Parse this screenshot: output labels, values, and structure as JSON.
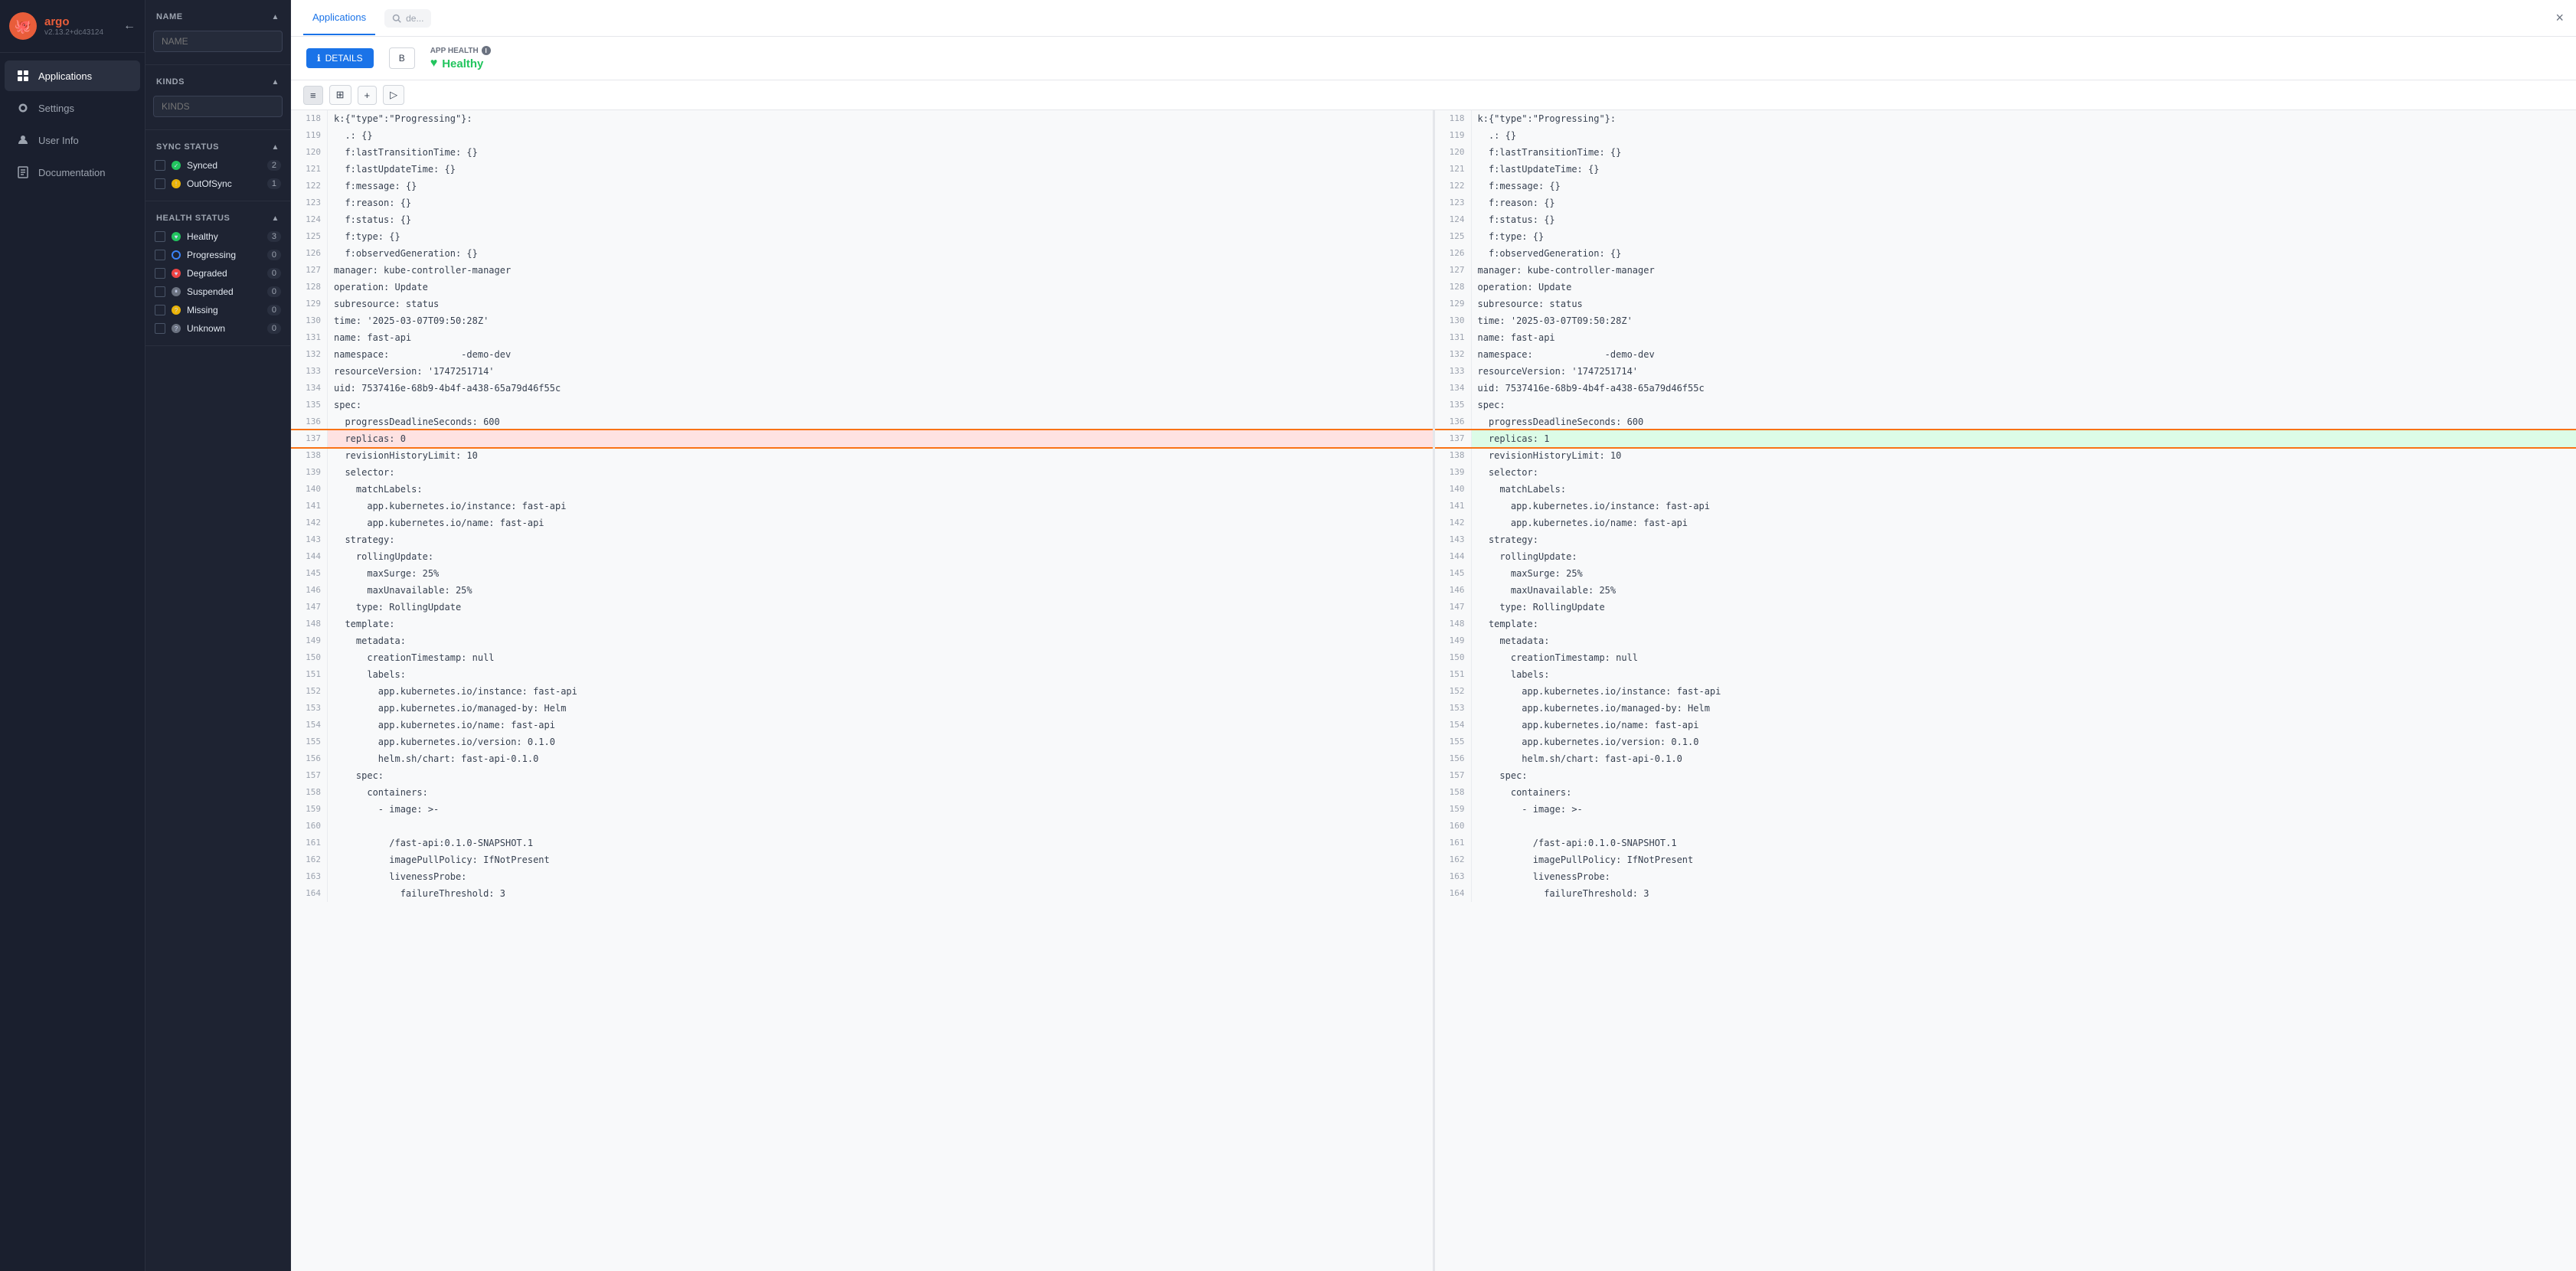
{
  "sidebar": {
    "logo": {
      "name": "argo",
      "version": "v2.13.2+dc43124"
    },
    "nav_items": [
      {
        "id": "applications",
        "label": "Applications",
        "icon": "grid",
        "active": true
      },
      {
        "id": "settings",
        "label": "Settings",
        "icon": "gear",
        "active": false
      },
      {
        "id": "user-info",
        "label": "User Info",
        "icon": "user",
        "active": false
      },
      {
        "id": "documentation",
        "label": "Documentation",
        "icon": "book",
        "active": false
      }
    ]
  },
  "filter": {
    "name_label": "NAME",
    "name_placeholder": "NAME",
    "kinds_label": "KINDS",
    "kinds_placeholder": "KINDS",
    "sync_status_label": "SYNC STATUS",
    "sync_items": [
      {
        "label": "Synced",
        "count": "2",
        "status": "synced"
      },
      {
        "label": "OutOfSync",
        "count": "1",
        "status": "outofsync"
      }
    ],
    "health_status_label": "HEALTH STATUS",
    "health_items": [
      {
        "label": "Healthy",
        "count": "3",
        "status": "healthy"
      },
      {
        "label": "Progressing",
        "count": "0",
        "status": "progressing"
      },
      {
        "label": "Degraded",
        "count": "0",
        "status": "degraded"
      },
      {
        "label": "Suspended",
        "count": "0",
        "status": "suspended"
      },
      {
        "label": "Missing",
        "count": "0",
        "status": "missing"
      },
      {
        "label": "Unknown",
        "count": "0",
        "status": "unknown"
      }
    ]
  },
  "topbar": {
    "tabs": [
      {
        "label": "Applications",
        "active": true
      },
      {
        "label": "de...",
        "active": false
      }
    ],
    "search_placeholder": "de..."
  },
  "app_header": {
    "details_btn": "DETAILS",
    "second_btn": "B",
    "health_label": "APP HEALTH",
    "health_info": "ℹ",
    "health_value": "Healthy"
  },
  "toolbar": {
    "icons": [
      "≡",
      "⊞",
      "+",
      "▷"
    ]
  },
  "diff": {
    "lines": [
      {
        "num": 118,
        "content": "k:{\"type\":\"Progressing\"}:"
      },
      {
        "num": 119,
        "content": "  .: {}"
      },
      {
        "num": 120,
        "content": "  f:lastTransitionTime: {}"
      },
      {
        "num": 121,
        "content": "  f:lastUpdateTime: {}"
      },
      {
        "num": 122,
        "content": "  f:message: {}"
      },
      {
        "num": 123,
        "content": "  f:reason: {}"
      },
      {
        "num": 124,
        "content": "  f:status: {}"
      },
      {
        "num": 125,
        "content": "  f:type: {}"
      },
      {
        "num": 126,
        "content": "  f:observedGeneration: {}"
      },
      {
        "num": 127,
        "content": "manager: kube-controller-manager"
      },
      {
        "num": 128,
        "content": "operation: Update"
      },
      {
        "num": 129,
        "content": "subresource: status"
      },
      {
        "num": 130,
        "content": "time: '2025-03-07T09:50:28Z'"
      },
      {
        "num": 131,
        "content": "name: fast-api"
      },
      {
        "num": 132,
        "content": "namespace:             -demo-dev"
      },
      {
        "num": 133,
        "content": "resourceVersion: '1747251714'"
      },
      {
        "num": 134,
        "content": "uid: 7537416e-68b9-4b4f-a438-65a79d46f55c"
      },
      {
        "num": 135,
        "content": "spec:"
      },
      {
        "num": 136,
        "content": "  progressDeadlineSeconds: 600"
      },
      {
        "num": 137,
        "content": "  replicas: 0",
        "highlight": "remove"
      },
      {
        "num": 138,
        "content": "  revisionHistoryLimit: 10"
      },
      {
        "num": 139,
        "content": "  selector:"
      },
      {
        "num": 140,
        "content": "    matchLabels:"
      },
      {
        "num": 141,
        "content": "      app.kubernetes.io/instance: fast-api"
      },
      {
        "num": 142,
        "content": "      app.kubernetes.io/name: fast-api"
      },
      {
        "num": 143,
        "content": "  strategy:"
      },
      {
        "num": 144,
        "content": "    rollingUpdate:"
      },
      {
        "num": 145,
        "content": "      maxSurge: 25%"
      },
      {
        "num": 146,
        "content": "      maxUnavailable: 25%"
      },
      {
        "num": 147,
        "content": "    type: RollingUpdate"
      },
      {
        "num": 148,
        "content": "  template:"
      },
      {
        "num": 149,
        "content": "    metadata:"
      },
      {
        "num": 150,
        "content": "      creationTimestamp: null"
      },
      {
        "num": 151,
        "content": "      labels:"
      },
      {
        "num": 152,
        "content": "        app.kubernetes.io/instance: fast-api"
      },
      {
        "num": 153,
        "content": "        app.kubernetes.io/managed-by: Helm"
      },
      {
        "num": 154,
        "content": "        app.kubernetes.io/name: fast-api"
      },
      {
        "num": 155,
        "content": "        app.kubernetes.io/version: 0.1.0"
      },
      {
        "num": 156,
        "content": "        helm.sh/chart: fast-api-0.1.0"
      },
      {
        "num": 157,
        "content": "    spec:"
      },
      {
        "num": 158,
        "content": "      containers:"
      },
      {
        "num": 159,
        "content": "        - image: >-"
      },
      {
        "num": 160,
        "content": ""
      },
      {
        "num": 161,
        "content": "          /fast-api:0.1.0-SNAPSHOT.1"
      },
      {
        "num": 162,
        "content": "          imagePullPolicy: IfNotPresent"
      },
      {
        "num": 163,
        "content": "          livenessProbe:"
      },
      {
        "num": 164,
        "content": "            failureThreshold: 3"
      }
    ],
    "right_lines": [
      {
        "num": 118,
        "content": "k:{\"type\":\"Progressing\"}:"
      },
      {
        "num": 119,
        "content": "  .: {}"
      },
      {
        "num": 120,
        "content": "  f:lastTransitionTime: {}"
      },
      {
        "num": 121,
        "content": "  f:lastUpdateTime: {}"
      },
      {
        "num": 122,
        "content": "  f:message: {}"
      },
      {
        "num": 123,
        "content": "  f:reason: {}"
      },
      {
        "num": 124,
        "content": "  f:status: {}"
      },
      {
        "num": 125,
        "content": "  f:type: {}"
      },
      {
        "num": 126,
        "content": "  f:observedGeneration: {}"
      },
      {
        "num": 127,
        "content": "manager: kube-controller-manager"
      },
      {
        "num": 128,
        "content": "operation: Update"
      },
      {
        "num": 129,
        "content": "subresource: status"
      },
      {
        "num": 130,
        "content": "time: '2025-03-07T09:50:28Z'"
      },
      {
        "num": 131,
        "content": "name: fast-api"
      },
      {
        "num": 132,
        "content": "namespace:             -demo-dev"
      },
      {
        "num": 133,
        "content": "resourceVersion: '1747251714'"
      },
      {
        "num": 134,
        "content": "uid: 7537416e-68b9-4b4f-a438-65a79d46f55c"
      },
      {
        "num": 135,
        "content": "spec:"
      },
      {
        "num": 136,
        "content": "  progressDeadlineSeconds: 600"
      },
      {
        "num": 137,
        "content": "  replicas: 1",
        "highlight": "add"
      },
      {
        "num": 138,
        "content": "  revisionHistoryLimit: 10"
      },
      {
        "num": 139,
        "content": "  selector:"
      },
      {
        "num": 140,
        "content": "    matchLabels:"
      },
      {
        "num": 141,
        "content": "      app.kubernetes.io/instance: fast-api"
      },
      {
        "num": 142,
        "content": "      app.kubernetes.io/name: fast-api"
      },
      {
        "num": 143,
        "content": "  strategy:"
      },
      {
        "num": 144,
        "content": "    rollingUpdate:"
      },
      {
        "num": 145,
        "content": "      maxSurge: 25%"
      },
      {
        "num": 146,
        "content": "      maxUnavailable: 25%"
      },
      {
        "num": 147,
        "content": "    type: RollingUpdate"
      },
      {
        "num": 148,
        "content": "  template:"
      },
      {
        "num": 149,
        "content": "    metadata:"
      },
      {
        "num": 150,
        "content": "      creationTimestamp: null"
      },
      {
        "num": 151,
        "content": "      labels:"
      },
      {
        "num": 152,
        "content": "        app.kubernetes.io/instance: fast-api"
      },
      {
        "num": 153,
        "content": "        app.kubernetes.io/managed-by: Helm"
      },
      {
        "num": 154,
        "content": "        app.kubernetes.io/name: fast-api"
      },
      {
        "num": 155,
        "content": "        app.kubernetes.io/version: 0.1.0"
      },
      {
        "num": 156,
        "content": "        helm.sh/chart: fast-api-0.1.0"
      },
      {
        "num": 157,
        "content": "    spec:"
      },
      {
        "num": 158,
        "content": "      containers:"
      },
      {
        "num": 159,
        "content": "        - image: >-"
      },
      {
        "num": 160,
        "content": ""
      },
      {
        "num": 161,
        "content": "          /fast-api:0.1.0-SNAPSHOT.1"
      },
      {
        "num": 162,
        "content": "          imagePullPolicy: IfNotPresent"
      },
      {
        "num": 163,
        "content": "          livenessProbe:"
      },
      {
        "num": 164,
        "content": "            failureThreshold: 3"
      }
    ]
  }
}
